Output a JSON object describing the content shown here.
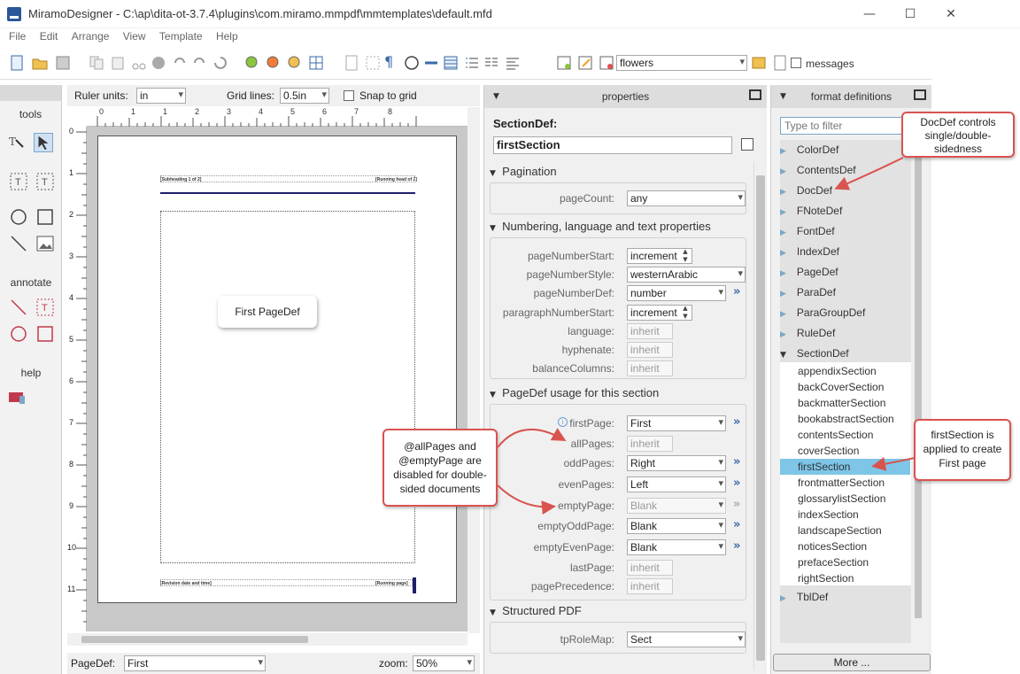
{
  "window": {
    "title": "MiramoDesigner - C:\\ap\\dita-ot-3.7.4\\plugins\\com.miramo.mmpdf\\mmtemplates\\default.mfd",
    "minimize": "—",
    "maximize": "☐",
    "close": "✕"
  },
  "menu": [
    "File",
    "Edit",
    "Arrange",
    "View",
    "Template",
    "Help"
  ],
  "toolbar": {
    "style_select": "flowers",
    "messages_label": "messages"
  },
  "leftdock": {
    "tools_label": "tools",
    "annotate_label": "annotate",
    "help_label": "help"
  },
  "canvas": {
    "ruler_units_label": "Ruler units:",
    "ruler_units_value": "in",
    "grid_lines_label": "Grid lines:",
    "grid_lines_value": "0.5in",
    "snap_label": "Snap to grid",
    "ruler_numbers": [
      "0",
      "1",
      "2",
      "3",
      "4",
      "5",
      "6",
      "7",
      "8"
    ],
    "vruler_numbers": [
      "0",
      "1",
      "2",
      "3",
      "4",
      "5",
      "6",
      "7",
      "8",
      "9",
      "10",
      "11"
    ],
    "header_left": "[Subheading 1 of 2]",
    "header_right": "[Running head of 2]",
    "footer_left": "[Revision date and time]",
    "footer_right": "[Running page]",
    "pagedef_label": "PageDef:",
    "pagedef_value": "First",
    "zoom_label": "zoom:",
    "zoom_value": "50%",
    "note": "First PageDef"
  },
  "properties": {
    "header": "properties",
    "section_def_label": "SectionDef:",
    "section_def_name": "firstSection",
    "pagination": {
      "title": "Pagination",
      "pageCount_label": "pageCount:",
      "pageCount_value": "any"
    },
    "numbering": {
      "title": "Numbering, language and text properties",
      "rows": [
        {
          "label": "pageNumberStart:",
          "value": "increment"
        },
        {
          "label": "pageNumberStyle:",
          "value": "westernArabic"
        },
        {
          "label": "pageNumberDef:",
          "value": "number"
        },
        {
          "label": "paragraphNumberStart:",
          "value": "increment"
        },
        {
          "label": "language:",
          "value": "inherit"
        },
        {
          "label": "hyphenate:",
          "value": "inherit"
        },
        {
          "label": "balanceColumns:",
          "value": "inherit"
        }
      ]
    },
    "pagedef_usage": {
      "title": "PageDef usage for this section",
      "rows": [
        {
          "label": "firstPage:",
          "value": "First"
        },
        {
          "label": "allPages:",
          "value": "inherit"
        },
        {
          "label": "oddPages:",
          "value": "Right"
        },
        {
          "label": "evenPages:",
          "value": "Left"
        },
        {
          "label": "emptyPage:",
          "value": "Blank"
        },
        {
          "label": "emptyOddPage:",
          "value": "Blank"
        },
        {
          "label": "emptyEvenPage:",
          "value": "Blank"
        },
        {
          "label": "lastPage:",
          "value": "inherit"
        },
        {
          "label": "pagePrecedence:",
          "value": "inherit"
        }
      ]
    },
    "structured_pdf": {
      "title": "Structured PDF",
      "tpRoleMap_label": "tpRoleMap:",
      "tpRoleMap_value": "Sect"
    }
  },
  "format_definitions": {
    "header": "format definitions",
    "filter_placeholder": "Type to filter",
    "items_before": [
      "ColorDef",
      "ContentsDef",
      "DocDef",
      "FNoteDef",
      "FontDef",
      "IndexDef",
      "PageDef",
      "ParaDef",
      "ParaGroupDef",
      "RuleDef"
    ],
    "expanded": "SectionDef",
    "children": [
      "appendixSection",
      "backCoverSection",
      "backmatterSection",
      "bookabstractSection",
      "contentsSection",
      "coverSection",
      "firstSection",
      "frontmatterSection",
      "glossarylistSection",
      "indexSection",
      "landscapeSection",
      "noticesSection",
      "prefaceSection",
      "rightSection"
    ],
    "selected": "firstSection",
    "items_after": [
      "TblDef"
    ],
    "more_button": "More ..."
  },
  "callouts": {
    "docdef": "DocDef controls single/double-sidedness",
    "allpages": "@allPages and @emptyPage are disabled for double-sided documents",
    "firstsection": "firstSection is applied to create First page"
  },
  "colors": {
    "accent": "#2b579a",
    "selection": "#7ec5e8",
    "callout_border": "#d9534f"
  }
}
